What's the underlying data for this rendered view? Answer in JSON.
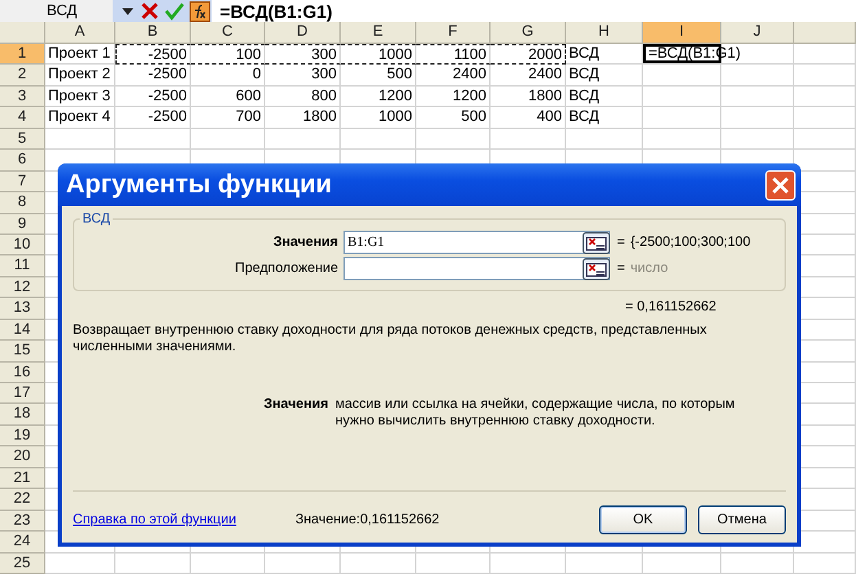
{
  "name_box": "ВСД",
  "formula_bar": {
    "text": "=ВСД(B1:G1)"
  },
  "columns": [
    {
      "label": "A",
      "selected": false
    },
    {
      "label": "B",
      "selected": false
    },
    {
      "label": "C",
      "selected": false
    },
    {
      "label": "D",
      "selected": false
    },
    {
      "label": "E",
      "selected": false
    },
    {
      "label": "F",
      "selected": false
    },
    {
      "label": "G",
      "selected": false
    },
    {
      "label": "H",
      "selected": false
    },
    {
      "label": "I",
      "selected": true
    },
    {
      "label": "J",
      "selected": false
    }
  ],
  "rows": [
    {
      "number": "1",
      "selected": true,
      "marquee": true,
      "cells": [
        "Проект 1",
        "-2500",
        "100",
        "300",
        "1000",
        "1100",
        "2000",
        "ВСД"
      ],
      "editing_cell": "=ВСД(B1:G1)"
    },
    {
      "number": "2",
      "selected": false,
      "marquee": false,
      "cells": [
        "Проект 2",
        "-2500",
        "0",
        "300",
        "500",
        "2400",
        "2400",
        "ВСД"
      ]
    },
    {
      "number": "3",
      "selected": false,
      "marquee": false,
      "cells": [
        "Проект 3",
        "-2500",
        "600",
        "800",
        "1200",
        "1200",
        "1800",
        "ВСД"
      ]
    },
    {
      "number": "4",
      "selected": false,
      "marquee": false,
      "cells": [
        "Проект 4",
        "-2500",
        "700",
        "1800",
        "1000",
        "500",
        "400",
        "ВСД"
      ]
    },
    {
      "number": "5",
      "selected": false
    },
    {
      "number": "6",
      "selected": false
    },
    {
      "number": "7",
      "selected": false
    },
    {
      "number": "8",
      "selected": false
    },
    {
      "number": "9",
      "selected": false
    },
    {
      "number": "10",
      "selected": false
    },
    {
      "number": "11",
      "selected": false
    },
    {
      "number": "12",
      "selected": false
    },
    {
      "number": "13",
      "selected": false
    },
    {
      "number": "14",
      "selected": false
    },
    {
      "number": "15",
      "selected": false
    },
    {
      "number": "16",
      "selected": false
    },
    {
      "number": "17",
      "selected": false
    },
    {
      "number": "18",
      "selected": false
    },
    {
      "number": "19",
      "selected": false
    },
    {
      "number": "20",
      "selected": false
    },
    {
      "number": "21",
      "selected": false
    },
    {
      "number": "22",
      "selected": false
    },
    {
      "number": "23",
      "selected": false
    },
    {
      "number": "24",
      "selected": false
    },
    {
      "number": "25",
      "selected": false
    }
  ],
  "dialog": {
    "title": "Аргументы функции",
    "function_name": "ВСД",
    "arguments": [
      {
        "label": "Значения",
        "bold": true,
        "value": "B1:G1",
        "equals": "=",
        "result": "{-2500;100;300;100",
        "hint": false
      },
      {
        "label": "Предположение",
        "bold": false,
        "equals": "=",
        "result": "число",
        "hint": true
      }
    ],
    "formula_result": "= 0,161152662",
    "description": "Возвращает внутреннюю ставку доходности для ряда потоков денежных средств, представленных численными значениями.",
    "argument_help": {
      "name": "Значения",
      "text": "массив или ссылка на ячейки, содержащие числа, по которым нужно вычислить внутреннюю ставку доходности."
    },
    "help_link": "Справка по этой функции",
    "value_text": "Значение:0,161152662",
    "buttons": [
      {
        "label": "OK",
        "default": true
      },
      {
        "label": "Отмена",
        "default": false
      }
    ]
  }
}
